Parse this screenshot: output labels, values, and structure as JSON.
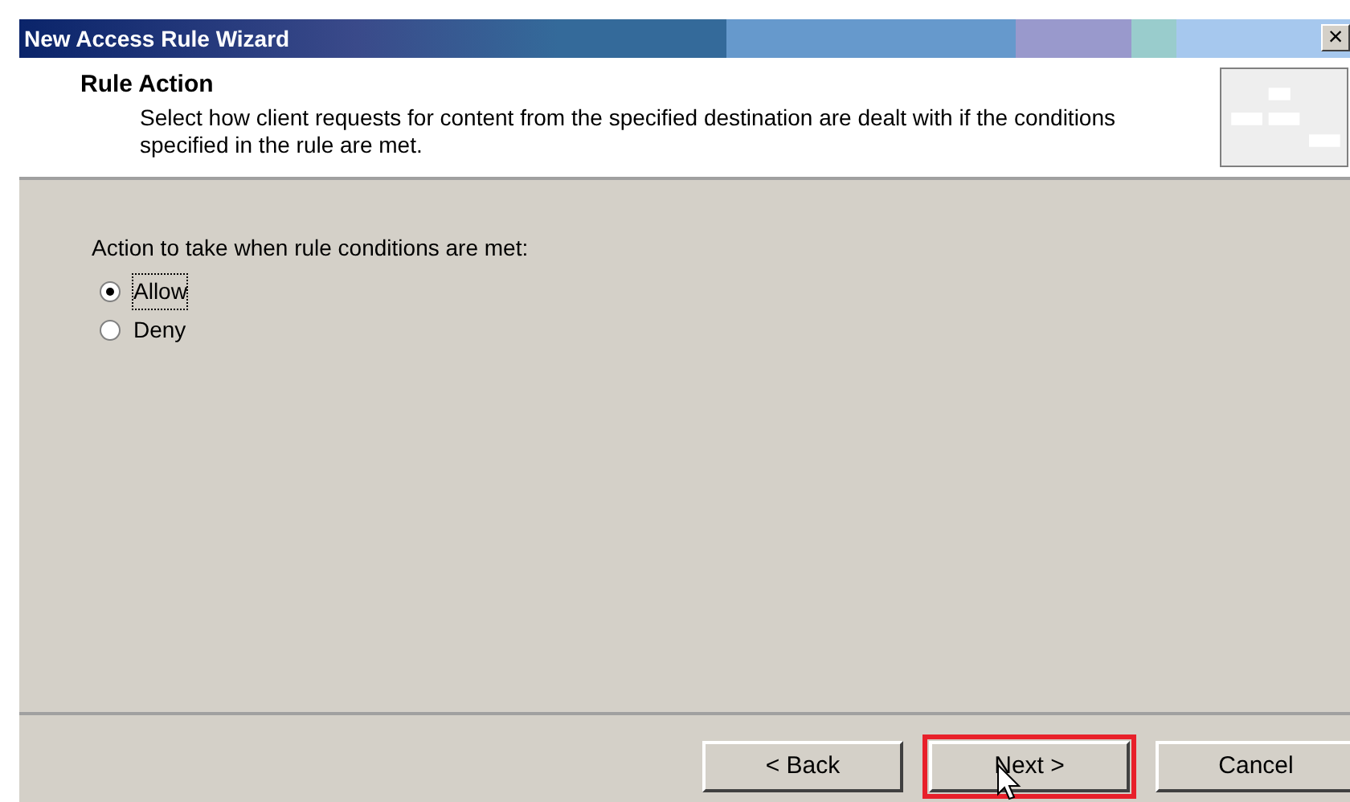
{
  "window": {
    "title": "New Access Rule Wizard",
    "close": "×"
  },
  "header": {
    "title": "Rule Action",
    "description": "Select how client requests for content from the specified destination are dealt with if the conditions specified in the rule are met."
  },
  "prompt": "Action to take when rule conditions are met:",
  "options": [
    {
      "label": "Allow",
      "selected": true,
      "focused": true
    },
    {
      "label": "Deny",
      "selected": false,
      "focused": false
    }
  ],
  "buttons": [
    {
      "label": "< Back",
      "highlighted": false
    },
    {
      "label": "Next >",
      "highlighted": true
    },
    {
      "label": "Cancel",
      "highlighted": false
    }
  ]
}
